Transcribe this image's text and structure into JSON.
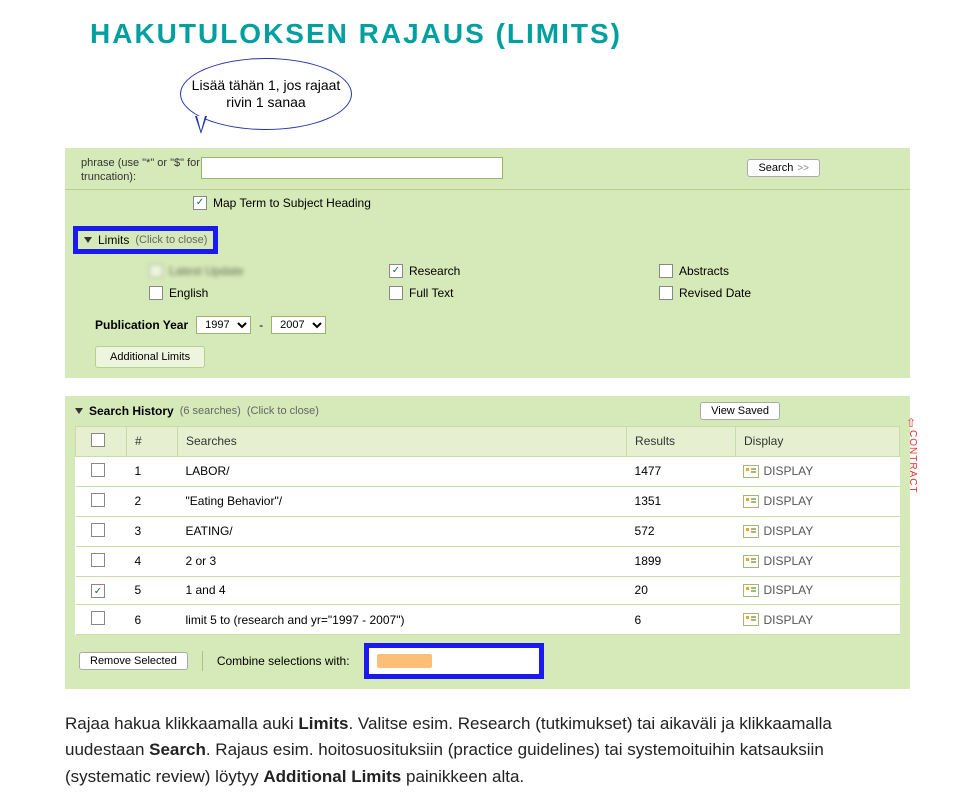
{
  "title": "HAKUTULOKSEN RAJAUS (LIMITS)",
  "callout": "Lisää tähän 1, jos rajaat rivin 1 sanaa",
  "search": {
    "keyword_left": "phrase (use \"*\" or \"$\" for truncation):",
    "button": "Search",
    "map_label": "Map Term to Subject Heading"
  },
  "limits": {
    "header": "Limits",
    "hint": "(Click to close)",
    "rows": [
      [
        "Latest Update",
        "Research",
        "Abstracts"
      ],
      [
        "English",
        "Full Text",
        "Revised Date"
      ]
    ],
    "checked": {
      "Research": true
    },
    "pubyear_label": "Publication Year",
    "year_from": "1997",
    "year_to": "2007",
    "additional": "Additional Limits"
  },
  "history": {
    "header": "Search History",
    "count": "(6 searches)",
    "hint": "(Click to close)",
    "view_saved": "View Saved",
    "cols": [
      "",
      "#",
      "Searches",
      "Results",
      "Display"
    ],
    "rows": [
      {
        "chk": false,
        "n": "1",
        "s": "LABOR/",
        "r": "1477"
      },
      {
        "chk": false,
        "n": "2",
        "s": "\"Eating Behavior\"/",
        "r": "1351"
      },
      {
        "chk": false,
        "n": "3",
        "s": "EATING/",
        "r": "572"
      },
      {
        "chk": false,
        "n": "4",
        "s": "2 or 3",
        "r": "1899"
      },
      {
        "chk": true,
        "n": "5",
        "s": "1 and 4",
        "r": "20"
      },
      {
        "chk": false,
        "n": "6",
        "s": "limit 5 to (research and yr=\"1997 - 2007\")",
        "r": "6"
      }
    ],
    "display_label": "DISPLAY",
    "remove": "Remove Selected",
    "combine": "Combine selections with:",
    "contract": "CONTRACT"
  },
  "caption": {
    "t1": "Rajaa hakua klikkaamalla auki ",
    "b1": "Limits",
    "t2": ". Valitse esim. Research (tutkimukset) tai aikaväli ja klikkaamalla uudestaan ",
    "b2": "Search",
    "t3": ". Rajaus esim. hoitosuosituksiin (practice guidelines) tai systemoituihin katsauksiin (systematic review) löytyy ",
    "b3": "Additional Limits",
    "t4": " painikkeen alta."
  }
}
